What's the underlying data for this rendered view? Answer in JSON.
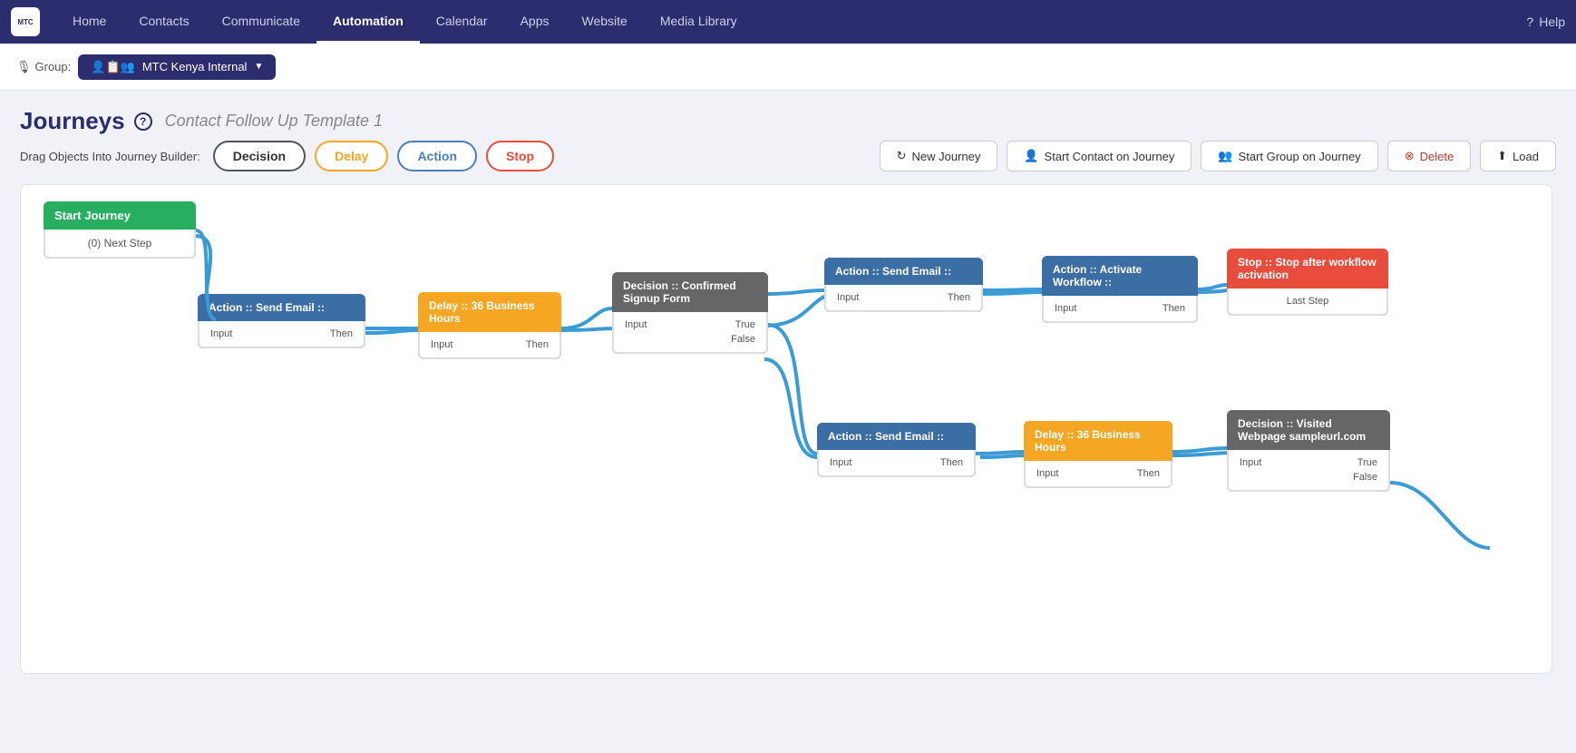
{
  "nav": {
    "logo_text": "MTC",
    "items": [
      {
        "label": "Home",
        "active": false
      },
      {
        "label": "Contacts",
        "active": false
      },
      {
        "label": "Communicate",
        "active": false
      },
      {
        "label": "Automation",
        "active": true
      },
      {
        "label": "Calendar",
        "active": false
      },
      {
        "label": "Apps",
        "active": false
      },
      {
        "label": "Website",
        "active": false
      },
      {
        "label": "Media Library",
        "active": false
      }
    ],
    "help_label": "Help"
  },
  "group_bar": {
    "label": "Group:",
    "selected": "MTC Kenya Internal"
  },
  "page": {
    "title": "Journeys",
    "subtitle": "Contact Follow Up Template 1"
  },
  "drag_objects": {
    "label": "Drag Objects Into Journey Builder:",
    "buttons": [
      {
        "label": "Decision",
        "type": "decision"
      },
      {
        "label": "Delay",
        "type": "delay"
      },
      {
        "label": "Action",
        "type": "action"
      },
      {
        "label": "Stop",
        "type": "stop"
      }
    ]
  },
  "action_buttons": [
    {
      "label": "New Journey",
      "type": "new-journey",
      "icon": "↻"
    },
    {
      "label": "Start Contact on Journey",
      "type": "start-contact",
      "icon": "👤"
    },
    {
      "label": "Start Group on Journey",
      "type": "start-group",
      "icon": "👥"
    },
    {
      "label": "Delete",
      "type": "delete",
      "icon": "⊗"
    },
    {
      "label": "Load",
      "type": "load",
      "icon": "⬆"
    }
  ],
  "nodes": {
    "start": {
      "header": "Start Journey",
      "body": "(0) Next Step"
    },
    "action1": {
      "header": "Action :: Send Email ::",
      "input": "Input",
      "then": "Then"
    },
    "delay1": {
      "header": "Delay :: 36 Business Hours",
      "input": "Input",
      "then": "Then"
    },
    "decision1": {
      "header": "Decision :: Confirmed Signup Form",
      "input": "Input",
      "true": "True",
      "false": "False"
    },
    "action2": {
      "header": "Action :: Send Email ::",
      "input": "Input",
      "then": "Then"
    },
    "action3": {
      "header": "Action :: Activate Workflow ::",
      "input": "Input",
      "then": "Then"
    },
    "stop1": {
      "header": "Stop :: Stop after workflow activation",
      "body": "Last Step"
    },
    "action4": {
      "header": "Action :: Send Email ::",
      "input": "Input",
      "then": "Then"
    },
    "delay2": {
      "header": "Delay :: 36 Business Hours",
      "input": "Input",
      "then": "Then"
    },
    "decision2": {
      "header": "Decision :: Visited Webpage sampleurl.com",
      "input": "Input",
      "true": "True",
      "false": "False"
    }
  }
}
